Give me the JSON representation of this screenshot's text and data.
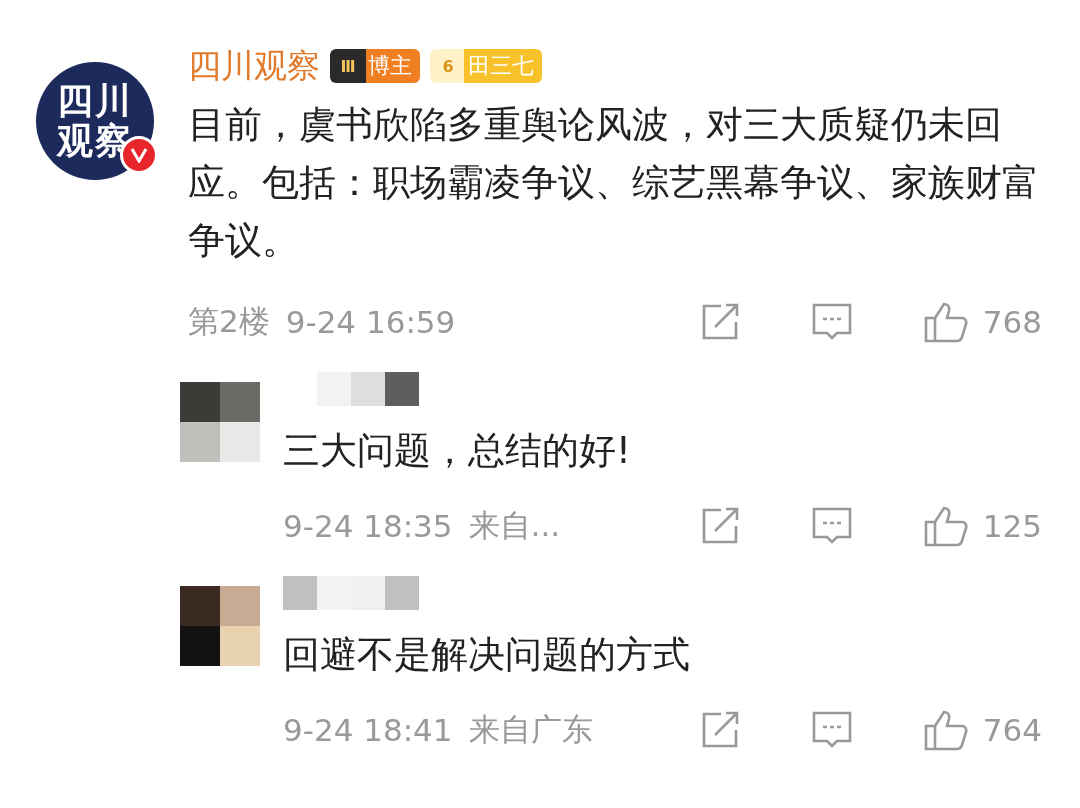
{
  "post": {
    "author": "四川观察",
    "logo_lines": [
      "四川",
      "观察"
    ],
    "verified": true,
    "badges": [
      {
        "kind": "crown",
        "label": "博主",
        "level": "Ⅲ"
      },
      {
        "kind": "fan",
        "label": "田三七",
        "level": "6"
      }
    ],
    "text": "目前，虞书欣陷多重舆论风波，对三大质疑仍未回应。包括：职场霸凌争议、综艺黑幕争议、家族财富争议。",
    "floor": "第2楼",
    "time": "9-24 16:59",
    "likes": "768"
  },
  "replies": [
    {
      "text": "三大问题，总结的好!",
      "time": "9-24 18:35",
      "location": "来自...",
      "likes": "125"
    },
    {
      "text": "回避不是解决问题的方式",
      "time": "9-24 18:41",
      "location": "来自广东",
      "likes": "764"
    }
  ]
}
